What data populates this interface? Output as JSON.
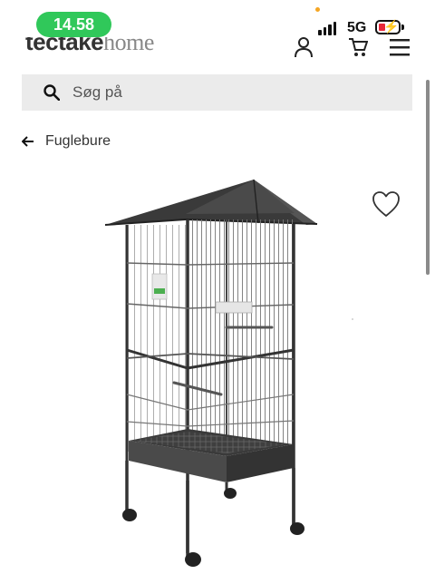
{
  "status_bar": {
    "time": "14.58",
    "network": "5G",
    "signal_bars": 4,
    "battery_level": 0.25,
    "battery_color": "#e8283a",
    "charging": true
  },
  "header": {
    "logo_bold": "tectake",
    "logo_light": "home",
    "icons": [
      "user-icon",
      "cart-icon",
      "menu-icon"
    ]
  },
  "search": {
    "placeholder": "Søg på",
    "value": ""
  },
  "breadcrumb": {
    "label": "Fuglebure"
  },
  "product": {
    "image_subject": "bird-cage",
    "wishlist_icon": "heart-outline-icon"
  },
  "colors": {
    "status_pill": "#30c85a",
    "search_bg": "#ebebeb",
    "cage": "#3a3a3a"
  }
}
